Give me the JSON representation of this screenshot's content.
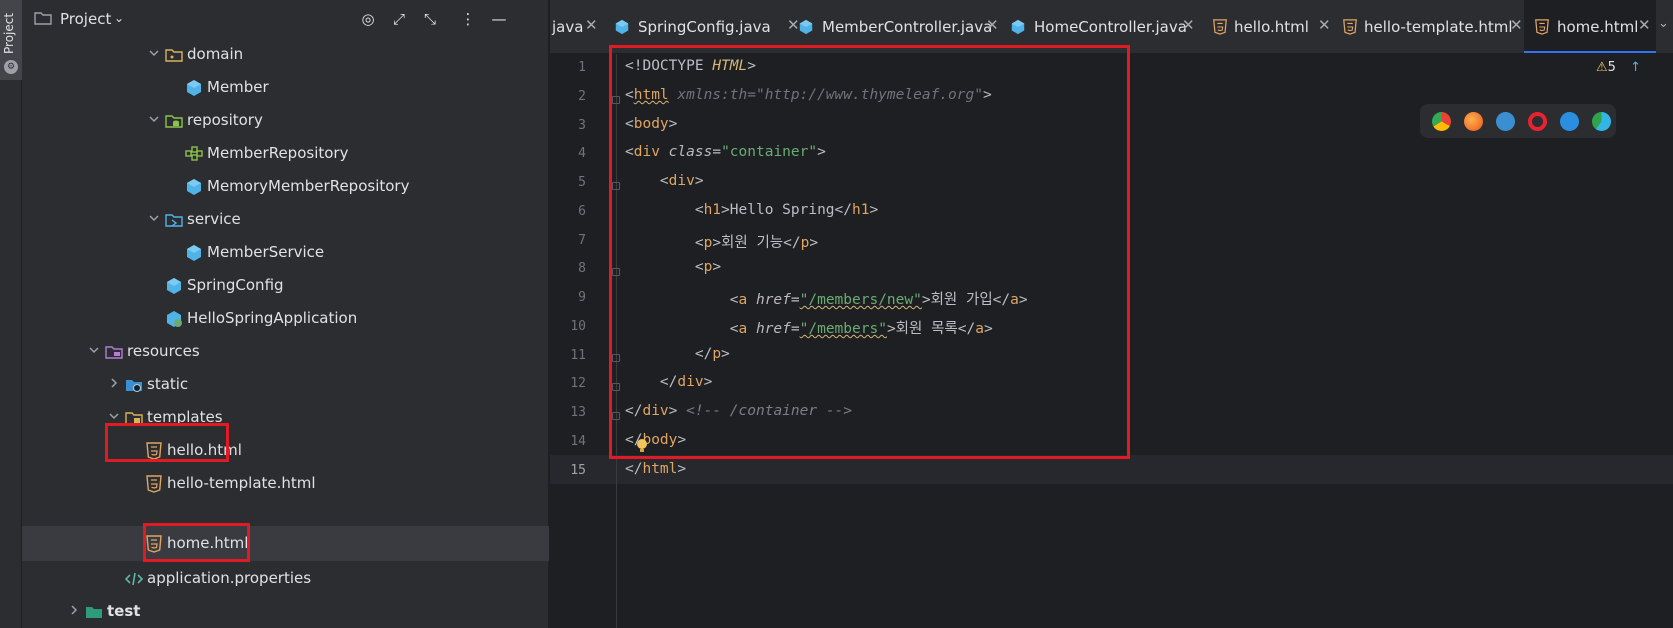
{
  "project_panel": {
    "title": "Project",
    "tool_strip_label": "Project",
    "tree": [
      {
        "label": "domain",
        "icon": "package-folder-icon",
        "expanded": true
      },
      {
        "label": "Member",
        "icon": "class-icon"
      },
      {
        "label": "repository",
        "icon": "db-package-icon",
        "expanded": true
      },
      {
        "label": "MemberRepository",
        "icon": "interface-icon"
      },
      {
        "label": "MemoryMemberRepository",
        "icon": "class-icon"
      },
      {
        "label": "service",
        "icon": "service-package-icon",
        "expanded": true
      },
      {
        "label": "MemberService",
        "icon": "class-icon"
      },
      {
        "label": "SpringConfig",
        "icon": "class-icon"
      },
      {
        "label": "HelloSpringApplication",
        "icon": "spring-app-icon"
      },
      {
        "label": "resources",
        "icon": "resources-folder-icon",
        "expanded": true
      },
      {
        "label": "static",
        "icon": "web-folder-icon",
        "expanded": false
      },
      {
        "label": "templates",
        "icon": "templates-folder-icon",
        "expanded": true
      },
      {
        "label": "hello.html",
        "icon": "html5-icon"
      },
      {
        "label": "hello-template.html",
        "icon": "html5-icon"
      },
      {
        "label": "home.html",
        "icon": "html5-icon",
        "selected": true
      },
      {
        "label": "application.properties",
        "icon": "properties-icon"
      },
      {
        "label": "test",
        "icon": "test-folder-icon",
        "expanded": false
      }
    ]
  },
  "tabs": [
    {
      "label": "java",
      "icon": "",
      "active": false
    },
    {
      "label": "SpringConfig.java",
      "icon": "class-icon",
      "active": false
    },
    {
      "label": "MemberController.java",
      "icon": "class-icon",
      "active": false
    },
    {
      "label": "HomeController.java",
      "icon": "class-icon",
      "active": false
    },
    {
      "label": "hello.html",
      "icon": "html5-icon",
      "active": false
    },
    {
      "label": "hello-template.html",
      "icon": "html5-icon",
      "active": false
    },
    {
      "label": "home.html",
      "icon": "html5-icon",
      "active": true
    }
  ],
  "editor": {
    "line_numbers": [
      "1",
      "2",
      "3",
      "4",
      "5",
      "6",
      "7",
      "8",
      "9",
      "10",
      "11",
      "12",
      "13",
      "14",
      "15"
    ],
    "current_line": "15",
    "lines": {
      "l1": {
        "a": "<!DOCTYPE ",
        "b": "HTML",
        "c": ">"
      },
      "l2": {
        "a": "<",
        "b": "html",
        "c": " ",
        "d": "xmlns:th",
        "e": "=",
        "f": "\"http://www.thymeleaf.org\"",
        "g": ">"
      },
      "l3": {
        "a": "<",
        "b": "body",
        "c": ">"
      },
      "l4": {
        "a": "<",
        "b": "div",
        "c": " ",
        "d": "class",
        "e": "=",
        "f": "\"container\"",
        "g": ">"
      },
      "l5": {
        "a": "    <",
        "b": "div",
        "c": ">"
      },
      "l6": {
        "a": "        <",
        "b": "h1",
        "c": ">Hello Spring</",
        "d": "h1",
        "e": ">"
      },
      "l7": {
        "a": "        <",
        "b": "p",
        "c": ">회원 기능</",
        "d": "p",
        "e": ">"
      },
      "l8": {
        "a": "        <",
        "b": "p",
        "c": ">"
      },
      "l9": {
        "a": "            <",
        "b": "a",
        "c": " ",
        "d": "href",
        "e": "=",
        "f": "\"/members/new\"",
        "g": ">회원 가입</",
        "h": "a",
        "i": ">"
      },
      "l10": {
        "a": "            <",
        "b": "a",
        "c": " ",
        "d": "href",
        "e": "=",
        "f": "\"/members\"",
        "g": ">회원 목록</",
        "h": "a",
        "i": ">"
      },
      "l11": {
        "a": "        </",
        "b": "p",
        "c": ">"
      },
      "l12": {
        "a": "    </",
        "b": "div",
        "c": ">"
      },
      "l13": {
        "a": "</",
        "b": "div",
        "c": "> ",
        "d": "<!-- /container -->"
      },
      "l14": {
        "a": "</",
        "b": "body",
        "c": ">"
      },
      "l15": {
        "a": "</",
        "b": "html",
        "c": ">"
      }
    }
  },
  "inspection": {
    "warnings": "5"
  },
  "browsers": [
    "chrome-icon",
    "firefox-icon",
    "safari-icon",
    "opera-icon",
    "ie-icon",
    "edge-icon"
  ],
  "colors": {
    "highlight_box": "#e01b24",
    "active_tab_underline": "#3574f0",
    "background": "#1e1f22",
    "panel": "#2b2d30"
  }
}
